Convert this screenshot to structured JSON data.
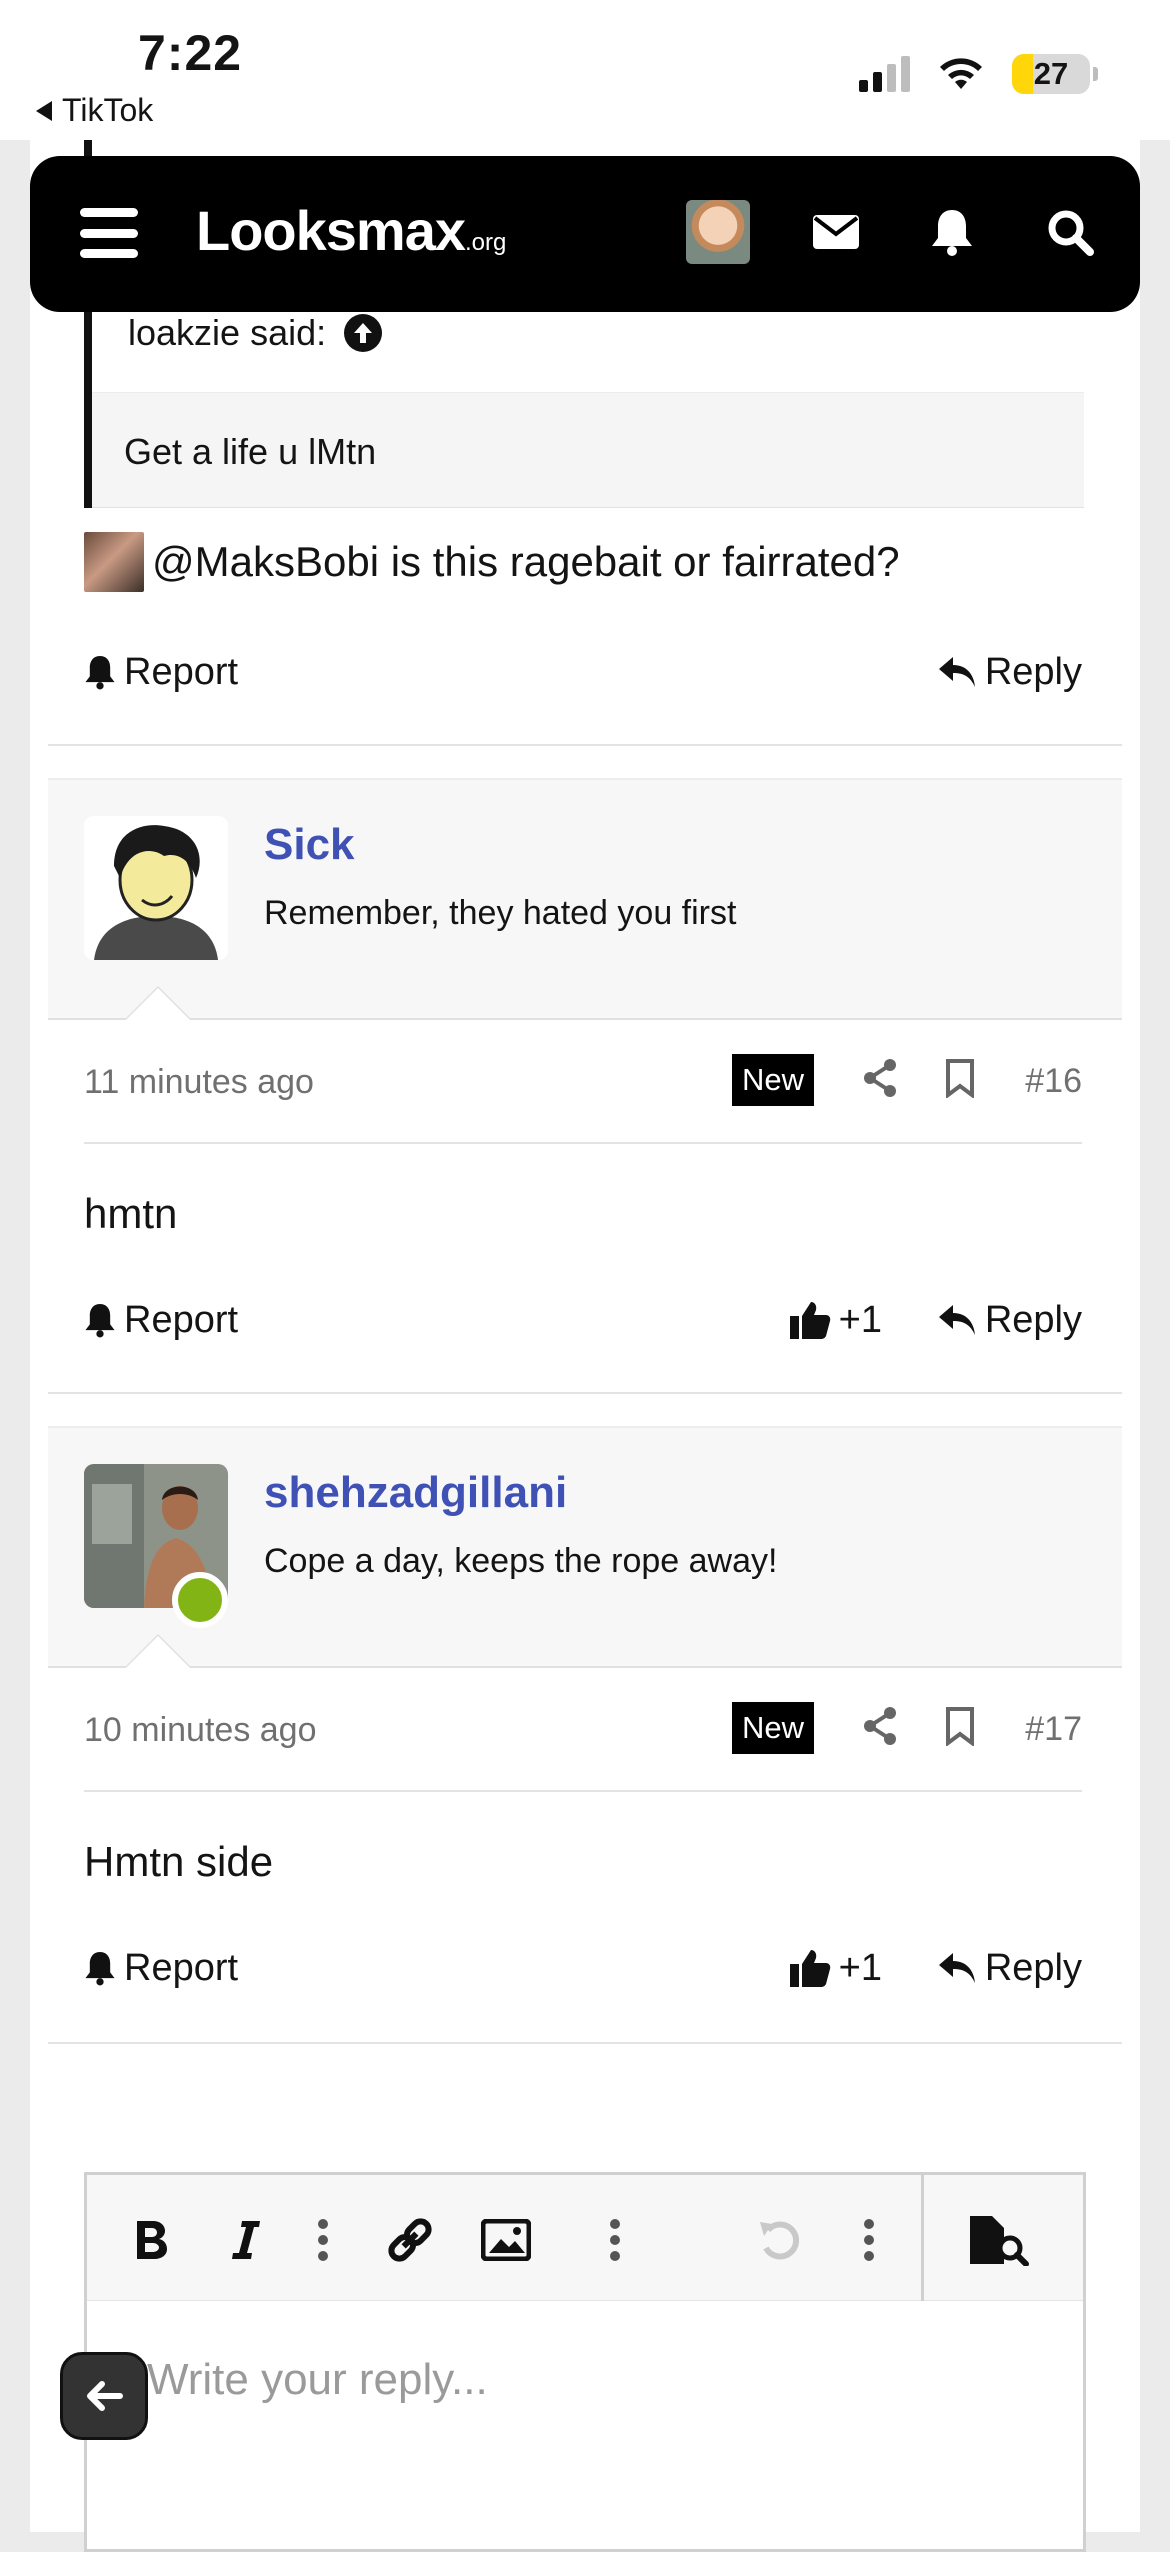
{
  "status_bar": {
    "time": "7:22",
    "back_app": "TikTok",
    "battery": "27",
    "battery_level": 0.27
  },
  "navbar": {
    "logo_main": "Looksmax",
    "logo_suffix": ".org"
  },
  "quote": {
    "author_line": "loakzie said:",
    "text": "Get a life u lMtn"
  },
  "post15": {
    "text": "@MaksBobi is this ragebait or fairrated?",
    "report": "Report",
    "reply": "Reply"
  },
  "post16": {
    "username": "Sick",
    "user_title": "Remember, they hated you first",
    "time": "11 minutes ago",
    "badge": "New",
    "number": "#16",
    "content": "hmtn",
    "report": "Report",
    "likes": "+1",
    "reply": "Reply"
  },
  "post17": {
    "username": "shehzadgillani",
    "user_title": "Cope a day, keeps the rope away!",
    "time": "10 minutes ago",
    "badge": "New",
    "number": "#17",
    "content": "Hmtn side",
    "report": "Report",
    "likes": "+1",
    "reply": "Reply"
  },
  "editor": {
    "placeholder": "Write your reply..."
  },
  "colors": {
    "accent_link": "#3f51b5",
    "online": "#82b416",
    "battery": "#ffd60a"
  },
  "icons": [
    "menu-icon",
    "envelope-icon",
    "bell-icon",
    "search-icon",
    "share-icon",
    "bookmark-icon",
    "thumbs-up-icon",
    "reply-icon",
    "bold-icon",
    "italic-icon",
    "link-icon",
    "image-icon",
    "undo-icon",
    "preview-icon",
    "arrow-left-icon"
  ]
}
